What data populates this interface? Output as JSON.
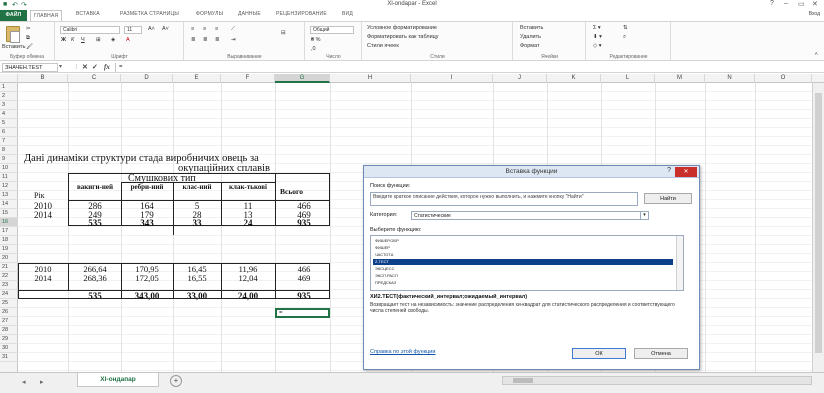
{
  "titlebar": {
    "title": "Xl-ondapar - Excel",
    "help": "?",
    "minimize": "–",
    "restore": "▭",
    "close": "✕"
  },
  "tabs": {
    "file": "ФАЙЛ",
    "items": [
      "ГЛАВНАЯ",
      "ВСТАВКА",
      "РАЗМЕТКА СТРАНИЦЫ",
      "ФОРМУЛЫ",
      "ДАННЫЕ",
      "РЕЦЕНЗИРОВАНИЕ",
      "ВИД"
    ],
    "login": "Вход"
  },
  "ribbon": {
    "paste": "Вставить",
    "clipboard": "Буфер обмена",
    "font_name": "Calibri",
    "font_size": "11",
    "bold": "Ж",
    "italic": "К",
    "underline": "Ч",
    "font_group": "Шрифт",
    "align_group": "Выравнивание",
    "number_format": "Общий",
    "number_group": "Число",
    "cond_format": "Условное форматирование",
    "format_table": "Форматировать как таблицу",
    "cell_styles": "Стили ячеек",
    "styles_group": "Стили",
    "insert": "Вставить",
    "delete": "Удалить",
    "format": "Формат",
    "cells_group": "Ячейки",
    "editing_group": "Редактирование"
  },
  "formula_bar": {
    "name_box": "ЗНАЧЕН.TEST",
    "cancel": "✕",
    "enter": "✓",
    "fx": "fx",
    "content": "="
  },
  "columns": [
    "A",
    "B",
    "C",
    "D",
    "E",
    "F",
    "G",
    "H",
    "I",
    "J",
    "K",
    "L",
    "M",
    "N",
    "O"
  ],
  "rows": [
    "1",
    "2",
    "3",
    "4",
    "5",
    "6",
    "7",
    "8",
    "9",
    "10",
    "11",
    "12",
    "13",
    "14",
    "15",
    "16",
    "17",
    "18",
    "19",
    "20",
    "21",
    "22",
    "23",
    "24",
    "25",
    "26",
    "27",
    "28",
    "29",
    "30",
    "31"
  ],
  "sheet": {
    "heading_line1": "Дані динаміки структури стада виробничих овець за",
    "heading_line2": "окупаційних сплавів",
    "group_header": "Смушкових тип",
    "col_year": "Рік",
    "col1": "вакиги-ней",
    "col2": "ребри-ний",
    "col3": "клас-ний",
    "col4": "клак-тькові",
    "col_total": "Всього",
    "table1": [
      [
        "2010",
        "286",
        "164",
        "5",
        "11",
        "466"
      ],
      [
        "2014",
        "249",
        "179",
        "28",
        "13",
        "469"
      ]
    ],
    "table1_totals": [
      "535",
      "343",
      "33",
      "24",
      "935"
    ],
    "table2": [
      [
        "2010",
        "266,64",
        "170,95",
        "16,45",
        "11,96",
        "466"
      ],
      [
        "2014",
        "268,36",
        "172,05",
        "16,55",
        "12,04",
        "469"
      ]
    ],
    "table2_totals": [
      "535",
      "343,00",
      "33,00",
      "24,00",
      "935"
    ],
    "active_cell": "="
  },
  "dialog": {
    "title": "Вставка функции",
    "help": "?",
    "close": "✕",
    "search_label": "Поиск функции:",
    "search_text": "Введите краткое описание действия, которое нужно выполнить, и нажмите кнопку \"Найти\"",
    "find_button": "Найти",
    "category_label": "Категория:",
    "category_value": "Статистические",
    "select_label": "Выберите функцию:",
    "functions": [
      "ФИШЕР.ОБР",
      "ФИШЕР",
      "ЧАСТОТА",
      "Z.ТЕСТ",
      "ЭКСЦЕСС",
      "ЭКСП.РАСП",
      "ПРЕДСКАЗ"
    ],
    "selected_index": 3,
    "signature": "ХИ2.ТЕСТ(фактический_интервал;ожидаемый_интервал)",
    "description": "Возвращает тест на независимость: значение распределения хи-квадрат для статистического распределения и соответствующего числа степеней свободы.",
    "help_link": "Справка по этой функции",
    "ok": "ОК",
    "cancel": "Отмена"
  },
  "sheetbar": {
    "prev": "◂",
    "next": "▸",
    "sheet_name": "Xl-ондапар",
    "add": "+"
  }
}
